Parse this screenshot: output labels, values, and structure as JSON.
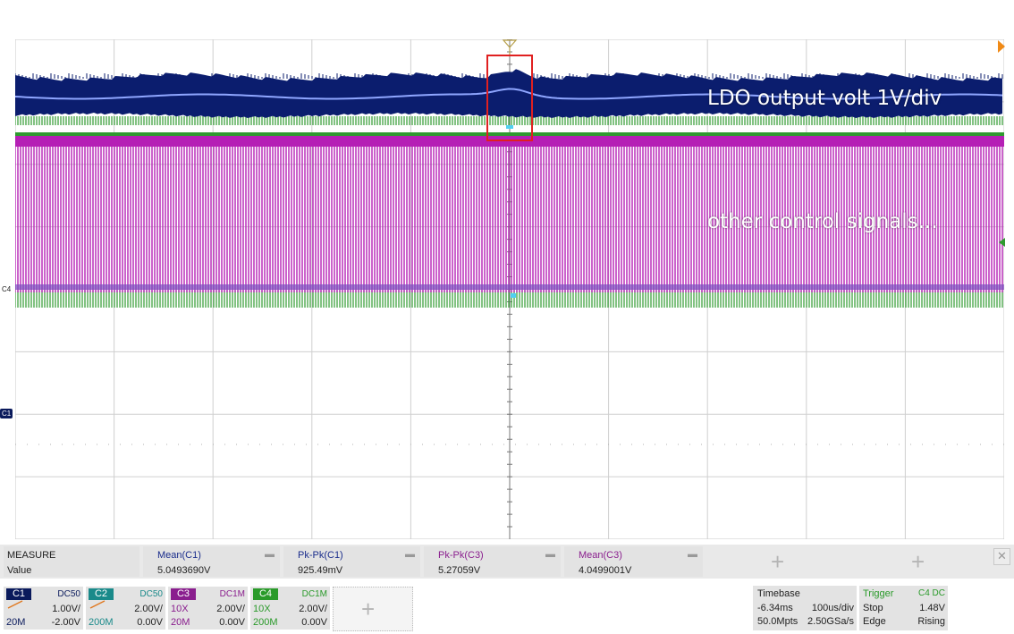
{
  "annotations": {
    "ldo": "LDO output volt 1V/div",
    "other": "other control signals..."
  },
  "markers": {
    "c4": "C4",
    "c1": "C1"
  },
  "measure": {
    "title": "MEASURE",
    "row_label": "Value",
    "items": [
      {
        "name": "Mean(C1)",
        "value": "5.0493690V"
      },
      {
        "name": "Pk-Pk(C1)",
        "value": "925.49mV"
      },
      {
        "name": "Pk-Pk(C3)",
        "value": "5.27059V"
      },
      {
        "name": "Mean(C3)",
        "value": "4.0499001V"
      }
    ]
  },
  "channels": [
    {
      "tag": "C1",
      "coupling": "DC50",
      "scale": "1.00V/",
      "bw": "20M",
      "offset": "-2.00V",
      "color": "#0a1a5c"
    },
    {
      "tag": "C2",
      "coupling": "DC50",
      "scale": "2.00V/",
      "bw": "200M",
      "offset": "0.00V",
      "color": "#1a8a8a"
    },
    {
      "tag": "C3",
      "coupling": "DC1M",
      "scale": "2.00V/",
      "bw": "20M",
      "offset": "0.00V",
      "probe": "10X",
      "color": "#8a1e8e"
    },
    {
      "tag": "C4",
      "coupling": "DC1M",
      "scale": "2.00V/",
      "bw": "200M",
      "offset": "0.00V",
      "probe": "10X",
      "color": "#2a9a2a"
    }
  ],
  "timebase": {
    "label": "Timebase",
    "delay": "-6.34ms",
    "scale": "100us/div",
    "points": "50.0Mpts",
    "rate": "2.50GSa/s"
  },
  "trigger": {
    "label": "Trigger",
    "source": "C4 DC",
    "mode": "Stop",
    "level": "1.48V",
    "type": "Edge",
    "slope": "Rising"
  },
  "colors": {
    "c1_trace": "#0b1d6e",
    "c1_core": "#8fa6ff",
    "c3_trace": "#b51fb5",
    "c4_trace": "#2f9a2f",
    "highlight_box": "#e02020",
    "trigger_marker": "#f08a16"
  },
  "icons": {
    "add_measure": "plus-icon",
    "close": "close-icon",
    "ramp": "probe-ramp-icon"
  }
}
